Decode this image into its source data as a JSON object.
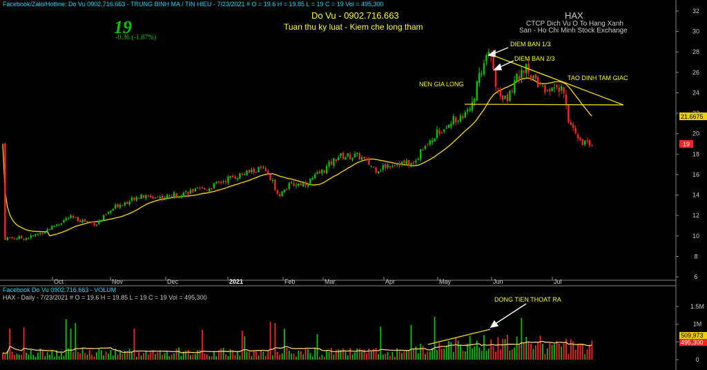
{
  "header": {
    "info_line": "Facebook/Zalo/Hotline: Do Vu 0902.716.663 - TRUNG BINH MA / TIN HIEU   - 7/23/2021   #   O = 19.6  H = 19.85  L = 19  C = 19  Vol = 495,300",
    "price_big": "19",
    "change": "-0.36  (-1.87%)",
    "author": "Do Vu - 0902.716.663",
    "motto": "Tuan thu ky luat - Kiem che long tham",
    "ticker": "HAX",
    "company": "CTCP Dich Vu O To Hang Xanh",
    "exchange": "San - Ho Chi Minh Stock Exchange"
  },
  "annotations": {
    "sell_1": "DIEM BAN 1/3",
    "sell_2": "DIEM BAN 2/3",
    "long_candle": "NEN GIA LONG",
    "triangle_top": "TAO DINH TAM GIAC",
    "money_out": "DONG TIEN THOAT RA"
  },
  "volume_panel": {
    "info_line_1": "Facebook Do Vu 0902.716.663 - VOLUM",
    "info_line_2": "HAX - Daily  - 7/23/2021   #   O = 19.6  H = 19.85  L = 19  C = 19  Vol = 495,300",
    "y_ticks": [
      "1.5M",
      "1M",
      "0.5M",
      "0"
    ],
    "last_volume_label": "495,300",
    "ma_label": "509,973"
  },
  "price_panel": {
    "y_ticks": [
      "6",
      "8",
      "10",
      "12",
      "14",
      "16",
      "18",
      "20",
      "22",
      "24",
      "26",
      "28",
      "30",
      "32"
    ],
    "ma_label": "21.6675",
    "last_price_label": "19"
  },
  "x_labels": [
    "Oct",
    "Nov",
    "Dec",
    "2021",
    "Feb",
    "Mar",
    "Apr",
    "May",
    "Jun",
    "Jul"
  ],
  "colors": {
    "background": "#000000",
    "up": "#00c800",
    "down": "#ff2020",
    "ma": "#f0d000",
    "axis_text": "#c8c8c8",
    "header_text": "#00e0ff",
    "title_text": "#ffff00"
  },
  "chart_data": {
    "type": "candlestick",
    "symbol": "HAX",
    "interval": "Daily",
    "last_bar": {
      "date": "7/23/2021",
      "open": 19.6,
      "high": 19.85,
      "low": 19,
      "close": 19,
      "volume": 495300
    },
    "price_ylim": [
      6,
      32
    ],
    "volume_ylim": [
      0,
      1500000
    ],
    "ma_last": 21.6675,
    "volume_ma_last": 509973,
    "months": [
      "Oct",
      "Nov",
      "Dec",
      "2021",
      "Feb",
      "Mar",
      "Apr",
      "May",
      "Jun",
      "Jul"
    ],
    "close_anchors": [
      {
        "date": "Sep 2020",
        "close": 9.8
      },
      {
        "date": "Oct 2020",
        "close": 11.8
      },
      {
        "date": "Nov 2020",
        "close": 13.6
      },
      {
        "date": "Dec 2020",
        "close": 14.8
      },
      {
        "date": "Jan 2021",
        "close": 16.2
      },
      {
        "date": "Feb 2021",
        "close": 15.2
      },
      {
        "date": "Mar 2021",
        "close": 17.8
      },
      {
        "date": "Apr 2021",
        "close": 17.2
      },
      {
        "date": "May 2021",
        "close": 20.5
      },
      {
        "date": "Jun 2021",
        "close": 26.5
      },
      {
        "date": "Jul 2021",
        "close": 24.5
      },
      {
        "date": "7/23/2021",
        "close": 19
      }
    ],
    "support_level": 23
  }
}
